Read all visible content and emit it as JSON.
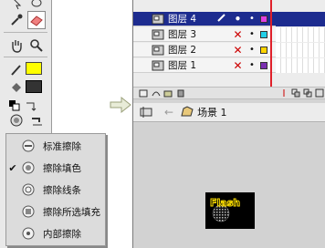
{
  "layers": [
    {
      "name": "图层 4",
      "selected": true,
      "visible_icon": "•",
      "lock_icon": "•",
      "color": "#e040e0"
    },
    {
      "name": "图层 3",
      "selected": false,
      "visible_icon": "✕",
      "lock_icon": "•",
      "color": "#22d0e8"
    },
    {
      "name": "图层 2",
      "selected": false,
      "visible_icon": "✕",
      "lock_icon": "•",
      "color": "#ffd400"
    },
    {
      "name": "图层 1",
      "selected": false,
      "visible_icon": "✕",
      "lock_icon": "•",
      "color": "#7a2fb0"
    }
  ],
  "eraser_menu": {
    "items": [
      {
        "label": "标准擦除",
        "checked": false
      },
      {
        "label": "擦除填色",
        "checked": true
      },
      {
        "label": "擦除线条",
        "checked": false
      },
      {
        "label": "擦除所选填充",
        "checked": false
      },
      {
        "label": "内部擦除",
        "checked": false
      }
    ]
  },
  "navbar": {
    "scene_label": "场景 1"
  },
  "stage": {
    "text": "Flash"
  },
  "colors": {
    "selected_layer": "#1d2c8f",
    "playhead": "#e0202a",
    "fill_swatch": "#ffff00"
  }
}
